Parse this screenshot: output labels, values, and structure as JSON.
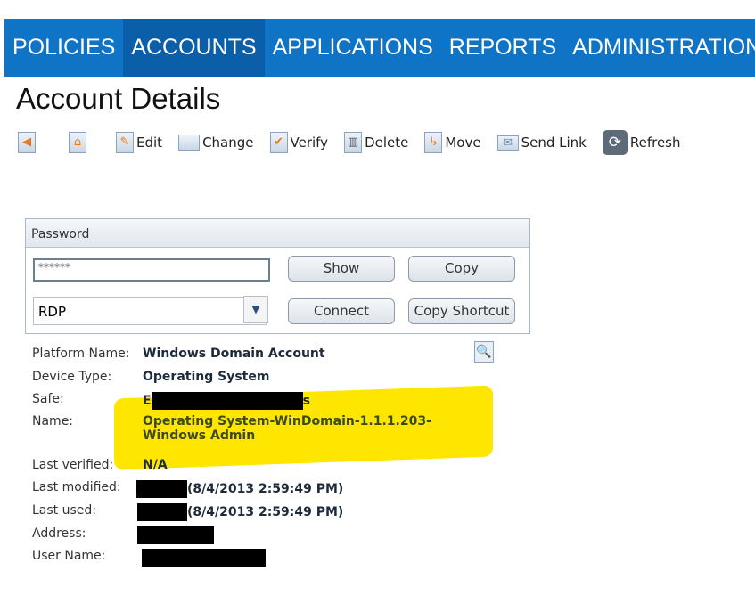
{
  "nav": [
    "POLICIES",
    "ACCOUNTS",
    "APPLICATIONS",
    "REPORTS",
    "ADMINISTRATION"
  ],
  "title": "Account Details",
  "toolbar": {
    "edit": "Edit",
    "change": "Change",
    "verify": "Verify",
    "delete": "Delete",
    "move": "Move",
    "send_link": "Send Link",
    "refresh": "Refresh"
  },
  "password": {
    "header": "Password",
    "value": "******",
    "show": "Show",
    "copy": "Copy",
    "connect": "Connect",
    "copy_shortcut": "Copy Shortcut",
    "connection": "RDP"
  },
  "details": {
    "platform_label": "Platform Name:",
    "platform": "Windows Domain Account",
    "device_label": "Device Type:",
    "device": "Operating System",
    "safe_label": "Safe:",
    "safe_start": "E",
    "safe_end": "s",
    "name_label": "Name:",
    "name1": "Operating System-WinDomain-1.1.1.203-",
    "name2": "Windows Admin",
    "verified_label": "Last verified:",
    "verified": "N/A",
    "modified_label": "Last modified:",
    "modified": "(8/4/2013 2:59:49 PM)",
    "used_label": "Last used:",
    "used": "(8/4/2013 2:59:49 PM)",
    "address_label": "Address:",
    "user_label": "User Name:"
  }
}
